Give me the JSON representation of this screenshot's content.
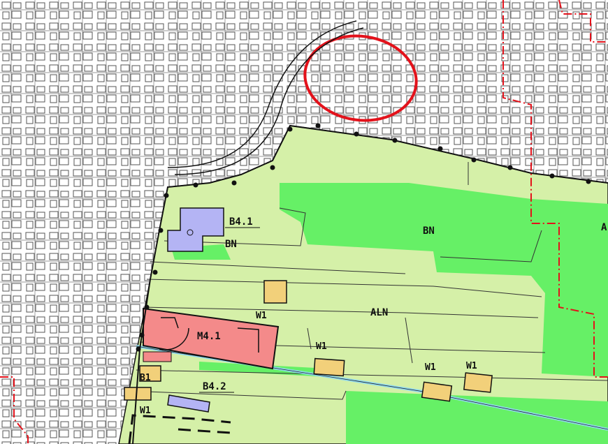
{
  "zones": {
    "b41": "B4.1",
    "bn_small": "BN",
    "bn_large": "BN",
    "aln": "ALN",
    "m41": "M4.1",
    "b42": "B4.2",
    "w1_a": "W1",
    "w1_b": "W1",
    "w1_c": "W1",
    "w1_d": "W1",
    "w1_e": "W1",
    "b1": "B1",
    "edge": "A"
  },
  "colors": {
    "agricultural": "#d5f0a8",
    "nature": "#66f066",
    "residential": "#b4b4f4",
    "mixed": "#f48a8a",
    "farmyard": "#f2d07a",
    "highlight_ring": "#e3121b",
    "boundary_dashdot": "#e3121b",
    "waterway": "#8fd9f0"
  }
}
